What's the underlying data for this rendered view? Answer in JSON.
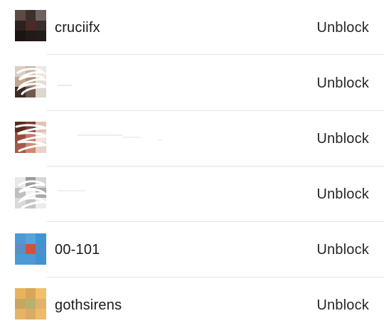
{
  "blocked_accounts": [
    {
      "username": "cruciifx",
      "action_label": "Unblock",
      "avatar_colors": [
        "#5a4b45",
        "#3d2f2c",
        "#6e625c",
        "#2c211f",
        "#4a2a27",
        "#3a2d2b",
        "#1c1413",
        "#231a18",
        "#241c1a"
      ]
    },
    {
      "username": "",
      "action_label": "Unblock",
      "avatar_colors": [
        "#d9cfc6",
        "#c7b7aa",
        "#efe8e2",
        "#c2a58f",
        "#b08f78",
        "#e6ddd5",
        "#3b2c24",
        "#6f5a4c",
        "#ded7d0"
      ]
    },
    {
      "username": "",
      "action_label": "Unblock",
      "avatar_colors": [
        "#5b2a22",
        "#7a3a2e",
        "#e2c3b7",
        "#9b4b3b",
        "#c4776a",
        "#f0e2dc",
        "#a45a48",
        "#cc8a75",
        "#e9d2c8"
      ]
    },
    {
      "username": "",
      "action_label": "Unblock",
      "avatar_colors": [
        "#e8e8e8",
        "#9a9a9a",
        "#d6d6d6",
        "#bfbfbf",
        "#f2f2f2",
        "#a9a9a9",
        "#d9d9d9",
        "#c4c4c4",
        "#ececec"
      ]
    },
    {
      "username": "00-101",
      "action_label": "Unblock",
      "avatar_colors": [
        "#4a9ad6",
        "#5aa3da",
        "#3f94d3",
        "#5b8fc2",
        "#d1523b",
        "#4d8fcd",
        "#4b9bd9",
        "#4e99d5",
        "#3f93d2"
      ]
    },
    {
      "username": "gothsirens",
      "action_label": "Unblock",
      "avatar_colors": [
        "#e8b35c",
        "#d8a658",
        "#f0c06a",
        "#c9a561",
        "#b6b16c",
        "#e0b26a",
        "#e7b463",
        "#d8ac62",
        "#efbb66"
      ]
    }
  ]
}
